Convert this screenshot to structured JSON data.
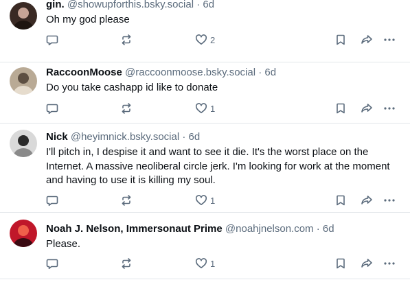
{
  "posts": [
    {
      "author": "gin.",
      "handle": "@showupforthis.bsky.social",
      "separator": "·",
      "time": "6d",
      "text": "Oh my god please",
      "likes": "2",
      "avatar_colors": [
        "#3a2a24",
        "#c7a496",
        "#1e1510"
      ]
    },
    {
      "author": "RaccoonMoose",
      "handle": "@raccoonmoose.bsky.social",
      "separator": "·",
      "time": "6d",
      "text": "Do you take cashapp id like to donate",
      "likes": "1",
      "avatar_colors": [
        "#b9aa95",
        "#5d4f42",
        "#e6dccd"
      ]
    },
    {
      "author": "Nick",
      "handle": "@heyimnick.bsky.social",
      "separator": "·",
      "time": "6d",
      "text": "I'll pitch in, I despise it and want to see it die. It's the worst place on the Internet. A massive neoliberal circle jerk. I'm looking for work at the moment and having to use it is killing my soul.",
      "likes": "1",
      "avatar_colors": [
        "#d9d9d9",
        "#2a2a2a",
        "#8a8a8a"
      ]
    },
    {
      "author": "Noah J. Nelson, Immersonaut Prime",
      "handle": "@noahjnelson.com",
      "separator": "·",
      "time": "6d",
      "text": "Please.",
      "likes": "1",
      "avatar_colors": [
        "#c0172a",
        "#f0604a",
        "#3b0b12"
      ]
    }
  ],
  "icons": {
    "reply": "reply-icon",
    "repost": "repost-icon",
    "like": "heart-icon",
    "bookmark": "bookmark-icon",
    "share": "share-icon",
    "more": "more-icon"
  },
  "colors": {
    "text": "#0b0f14",
    "muted": "#5b6b7c",
    "divider": "#e2e6ea"
  }
}
